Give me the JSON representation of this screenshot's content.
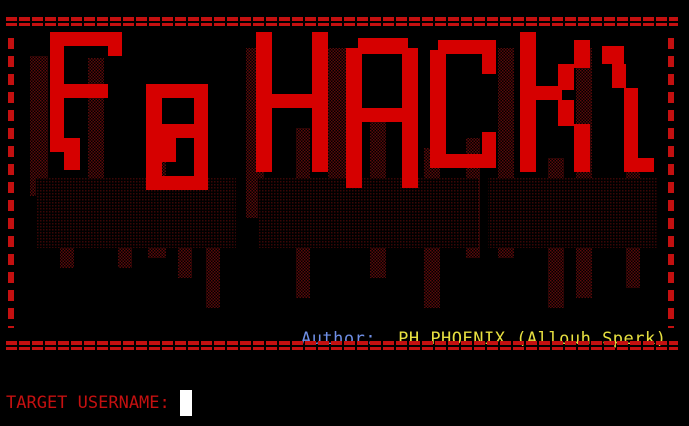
{
  "banner": {
    "text": "FB HACK",
    "icon": "ascii-art-logo",
    "color": "#d60000"
  },
  "author": {
    "label": "Author:",
    "value": "PH.PHOENIX (Allouh Sperk)"
  },
  "prompt": {
    "label": "TARGET USERNAME:",
    "input_value": ""
  },
  "colors": {
    "background": "#000000",
    "accent_red": "#c41010",
    "author_label": "#6f8fe6",
    "author_value": "#e7e040",
    "cursor": "#ffffff"
  }
}
